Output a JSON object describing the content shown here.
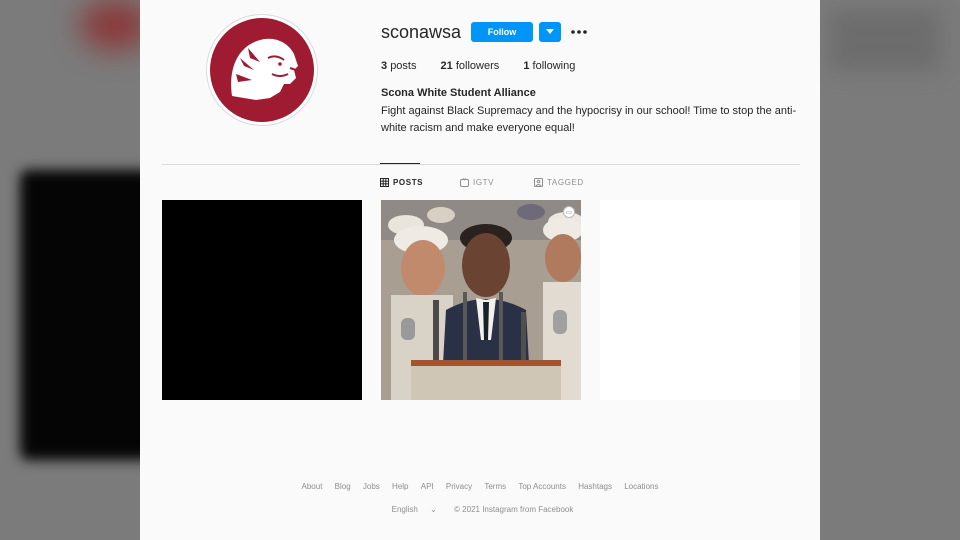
{
  "profile": {
    "username": "sconawsa",
    "follow_label": "Follow",
    "more_icon": "more-horizontal-icon",
    "stats": {
      "posts_count": "3",
      "posts_label": "posts",
      "followers_count": "21",
      "followers_label": "followers",
      "following_count": "1",
      "following_label": "following"
    },
    "full_name": "Scona White Student Alliance",
    "bio": "Fight against Black Supremacy and the hypocrisy in our school! Time to stop the anti-white racism and make everyone equal!"
  },
  "tabs": [
    {
      "label": "POSTS",
      "icon": "grid-icon",
      "active": true
    },
    {
      "label": "IGTV",
      "icon": "igtv-icon",
      "active": false
    },
    {
      "label": "TAGGED",
      "icon": "tag-icon",
      "active": false
    }
  ],
  "posts": [
    {
      "kind": "black"
    },
    {
      "kind": "photo",
      "carousel": true
    },
    {
      "kind": "white"
    }
  ],
  "footer": {
    "links": [
      "About",
      "Blog",
      "Jobs",
      "Help",
      "API",
      "Privacy",
      "Terms",
      "Top Accounts",
      "Hashtags",
      "Locations"
    ],
    "language": "English",
    "copyright": "© 2021 Instagram from Facebook"
  },
  "colors": {
    "accent": "#0095f6",
    "avatar_red": "#9e1b32"
  }
}
